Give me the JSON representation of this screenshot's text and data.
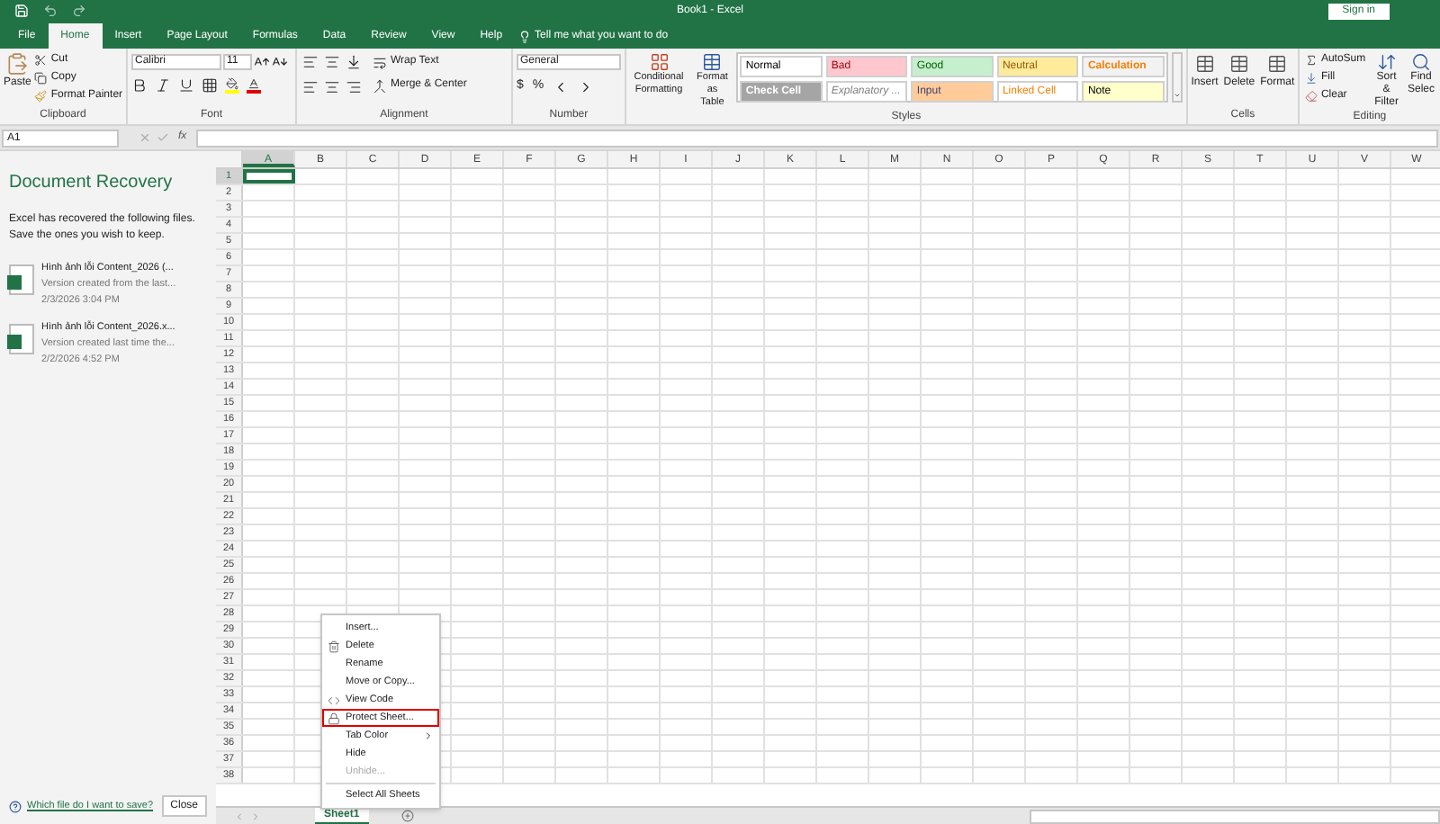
{
  "title_bar": {
    "title": "Book1  -  Excel",
    "sign_in": "Sign in"
  },
  "tabs": [
    {
      "label": "File",
      "selected": false
    },
    {
      "label": "Home",
      "selected": true
    },
    {
      "label": "Insert",
      "selected": false
    },
    {
      "label": "Page Layout",
      "selected": false
    },
    {
      "label": "Formulas",
      "selected": false
    },
    {
      "label": "Data",
      "selected": false
    },
    {
      "label": "Review",
      "selected": false
    },
    {
      "label": "View",
      "selected": false
    },
    {
      "label": "Help",
      "selected": false
    }
  ],
  "tell_me": "Tell me what you want to do",
  "ribbon": {
    "clipboard": {
      "label": "Clipboard",
      "paste": "Paste",
      "cut": "Cut",
      "copy": "Copy",
      "format_painter": "Format Painter"
    },
    "font": {
      "label": "Font",
      "font_name": "Calibri",
      "font_size": "11"
    },
    "alignment": {
      "label": "Alignment",
      "wrap_text": "Wrap Text",
      "merge_center": "Merge & Center"
    },
    "number": {
      "label": "Number",
      "format": "General",
      "currency": "$",
      "percent": "%"
    },
    "styles": {
      "label": "Styles",
      "conditional_formatting": [
        "Conditional",
        "Formatting"
      ],
      "format_as_table": [
        "Format as",
        "Table"
      ],
      "cells": [
        {
          "label": "Normal",
          "color": "#ffffff"
        },
        {
          "label": "Bad",
          "color": "#ffc7ce"
        },
        {
          "label": "Good",
          "color": "#c6efce"
        },
        {
          "label": "Neutral",
          "color": "#ffeb9c"
        },
        {
          "label": "Calculation",
          "color": "#f2f2f2"
        },
        {
          "label": "Check Cell",
          "color": "#a5a5a5"
        },
        {
          "label": "Explanatory ...",
          "color": "#ffffff"
        },
        {
          "label": "Input",
          "color": "#ffcc99"
        },
        {
          "label": "Linked Cell",
          "color": "#ffffff"
        },
        {
          "label": "Note",
          "color": "#ffffcc"
        }
      ]
    },
    "cells": {
      "label": "Cells",
      "buttons": [
        "Insert",
        "Delete",
        "Format"
      ]
    },
    "editing": {
      "label": "Editing",
      "autosum": "AutoSum",
      "fill": "Fill",
      "clear": "Clear",
      "sort_filter": [
        "Sort &",
        "Filter"
      ],
      "find": [
        "Find",
        "Selec"
      ]
    }
  },
  "formula_bar": {
    "name_box": "A1",
    "function_label": "fx"
  },
  "recovery": {
    "title": "Document Recovery",
    "description": "Excel has recovered the following files.  Save the ones you wish to keep.",
    "files": [
      {
        "name": "Hình ảnh lỗi Content_2026 (...",
        "detail": "Version created from the last...",
        "date": "2/3/2026 3:04 PM"
      },
      {
        "name": "Hình ảnh lỗi Content_2026.x...",
        "detail": "Version created last time the...",
        "date": "2/2/2026 4:52 PM"
      }
    ],
    "help_link": "Which file do I want to save?",
    "close": "Close"
  },
  "grid": {
    "columns": [
      {
        "label": "A",
        "selected": true
      },
      {
        "label": "B",
        "selected": false
      },
      {
        "label": "C",
        "selected": false
      },
      {
        "label": "D",
        "selected": false
      },
      {
        "label": "E",
        "selected": false
      },
      {
        "label": "F",
        "selected": false
      },
      {
        "label": "G",
        "selected": false
      },
      {
        "label": "H",
        "selected": false
      },
      {
        "label": "I",
        "selected": false
      },
      {
        "label": "J",
        "selected": false
      },
      {
        "label": "K",
        "selected": false
      },
      {
        "label": "L",
        "selected": false
      },
      {
        "label": "M",
        "selected": false
      },
      {
        "label": "N",
        "selected": false
      },
      {
        "label": "O",
        "selected": false
      },
      {
        "label": "P",
        "selected": false
      },
      {
        "label": "Q",
        "selected": false
      },
      {
        "label": "R",
        "selected": false
      },
      {
        "label": "S",
        "selected": false
      },
      {
        "label": "T",
        "selected": false
      },
      {
        "label": "U",
        "selected": false
      },
      {
        "label": "V",
        "selected": false
      },
      {
        "label": "W",
        "selected": false
      }
    ],
    "rows": [
      {
        "label": "1",
        "selected": true
      },
      {
        "label": "2",
        "selected": false
      },
      {
        "label": "3",
        "selected": false
      },
      {
        "label": "4",
        "selected": false
      },
      {
        "label": "5",
        "selected": false
      },
      {
        "label": "6",
        "selected": false
      },
      {
        "label": "7",
        "selected": false
      },
      {
        "label": "8",
        "selected": false
      },
      {
        "label": "9",
        "selected": false
      },
      {
        "label": "10",
        "selected": false
      },
      {
        "label": "11",
        "selected": false
      },
      {
        "label": "12",
        "selected": false
      },
      {
        "label": "13",
        "selected": false
      },
      {
        "label": "14",
        "selected": false
      },
      {
        "label": "15",
        "selected": false
      },
      {
        "label": "16",
        "selected": false
      },
      {
        "label": "17",
        "selected": false
      },
      {
        "label": "18",
        "selected": false
      },
      {
        "label": "19",
        "selected": false
      },
      {
        "label": "20",
        "selected": false
      },
      {
        "label": "21",
        "selected": false
      },
      {
        "label": "22",
        "selected": false
      },
      {
        "label": "23",
        "selected": false
      },
      {
        "label": "24",
        "selected": false
      },
      {
        "label": "25",
        "selected": false
      },
      {
        "label": "26",
        "selected": false
      },
      {
        "label": "27",
        "selected": false
      },
      {
        "label": "28",
        "selected": false
      },
      {
        "label": "29",
        "selected": false
      },
      {
        "label": "30",
        "selected": false
      },
      {
        "label": "31",
        "selected": false
      },
      {
        "label": "32",
        "selected": false
      },
      {
        "label": "33",
        "selected": false
      },
      {
        "label": "34",
        "selected": false
      },
      {
        "label": "35",
        "selected": false
      },
      {
        "label": "36",
        "selected": false
      },
      {
        "label": "37",
        "selected": false
      },
      {
        "label": "38",
        "selected": false
      }
    ]
  },
  "context_menu": [
    {
      "label": "Insert...",
      "kind": "plain",
      "disabled": false,
      "highlighted": false
    },
    {
      "label": "Delete",
      "kind": "delete",
      "disabled": false,
      "highlighted": false
    },
    {
      "label": "Rename",
      "kind": "plain",
      "disabled": false,
      "highlighted": false
    },
    {
      "label": "Move or Copy...",
      "kind": "plain",
      "disabled": false,
      "highlighted": false
    },
    {
      "label": "View Code",
      "kind": "code",
      "disabled": false,
      "highlighted": false
    },
    {
      "label": "Protect Sheet...",
      "kind": "protect",
      "disabled": false,
      "highlighted": true
    },
    {
      "label": "Tab Color",
      "kind": "submenu",
      "disabled": false,
      "highlighted": false
    },
    {
      "label": "Hide",
      "kind": "plain",
      "disabled": false,
      "highlighted": false
    },
    {
      "label": "Unhide...",
      "kind": "plain",
      "disabled": true,
      "highlighted": false
    },
    {
      "label": "Select All Sheets",
      "kind": "separated",
      "disabled": false,
      "highlighted": false
    }
  ],
  "sheet_tabs": [
    {
      "label": "Sheet1",
      "selected": true
    }
  ]
}
